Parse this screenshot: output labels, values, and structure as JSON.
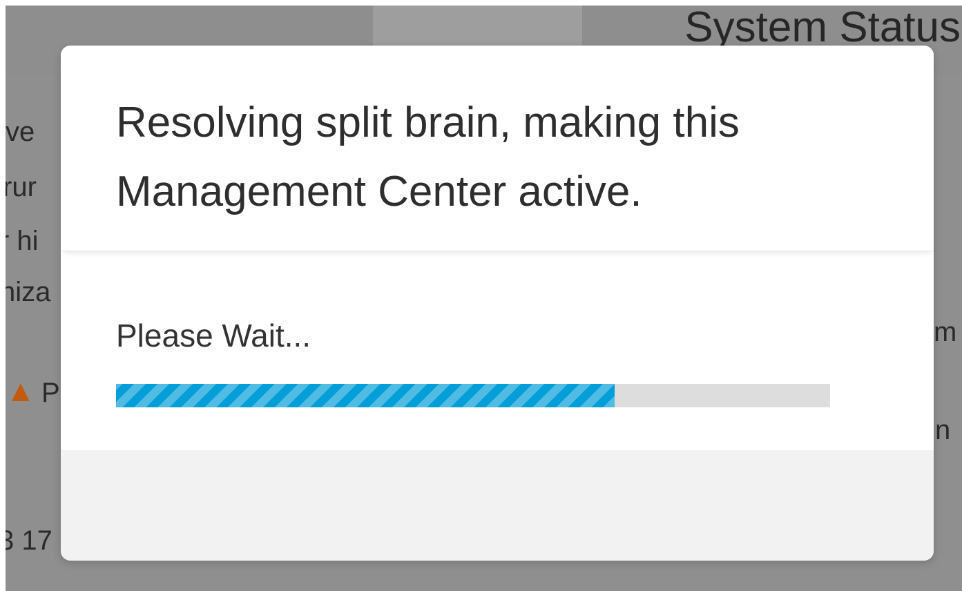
{
  "background": {
    "header_title": "System Status",
    "left_fragments": [
      "ve",
      "rur",
      "r hi",
      "niza",
      "P",
      "3 17"
    ],
    "right_fragments": [
      "m",
      "n"
    ],
    "warning_icon": "warning-triangle-icon"
  },
  "dialog": {
    "title": "Resolving split brain, making this Management Center active.",
    "status_text": "Please Wait...",
    "progress_fraction": 0.698,
    "accent_color": "#049fd9"
  }
}
